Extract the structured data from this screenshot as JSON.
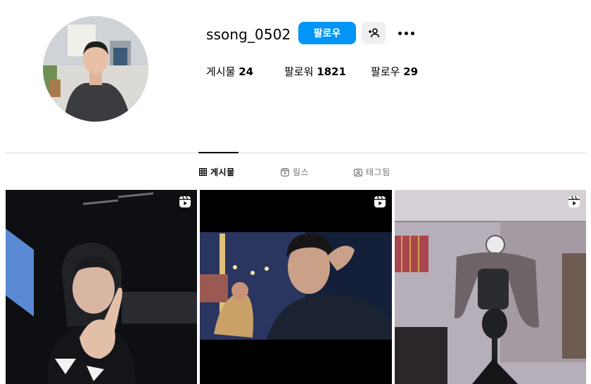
{
  "profile": {
    "username": "ssong_0502",
    "follow_label": "팔로우",
    "avatar_alt": "avatar"
  },
  "stats": {
    "posts": {
      "label": "게시물",
      "value": "24"
    },
    "followers": {
      "label": "팔로워",
      "value": "1821"
    },
    "following": {
      "label": "팔로우",
      "value": "29"
    }
  },
  "tabs": [
    {
      "label": "게시물",
      "icon": "grid-icon",
      "active": true
    },
    {
      "label": "릴스",
      "icon": "reels-icon",
      "active": false
    },
    {
      "label": "태그됨",
      "icon": "tagged-icon",
      "active": false
    }
  ],
  "posts": [
    {
      "type": "reel",
      "icon": "reel-icon"
    },
    {
      "type": "reel",
      "icon": "reel-icon"
    },
    {
      "type": "reel",
      "icon": "reel-icon"
    }
  ],
  "colors": {
    "accent": "#0095f6",
    "secondary_button": "#efefef",
    "divider": "#dbdbdb",
    "muted_text": "#737373"
  }
}
